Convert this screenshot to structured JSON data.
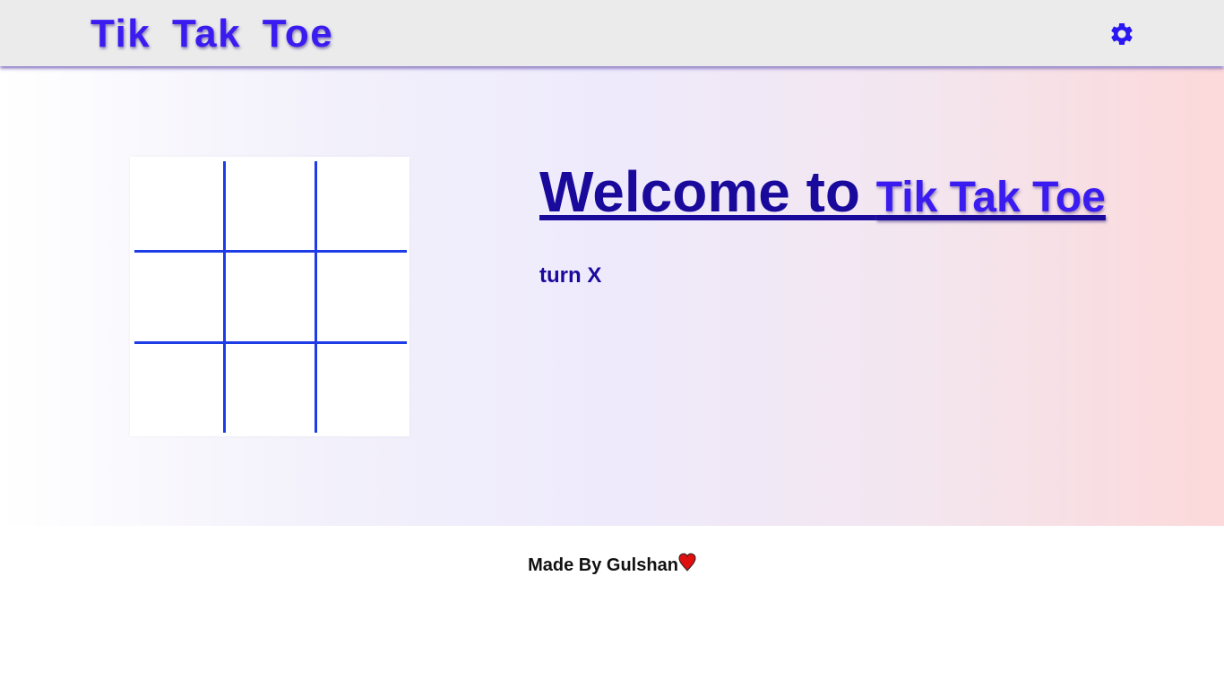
{
  "navbar": {
    "brand": "Tik  Tak  Toe",
    "settings_icon": "gear-icon",
    "brand_color": "#3a1cf0"
  },
  "board": {
    "cells": [
      "",
      "",
      "",
      "",
      "",
      "",
      "",
      "",
      ""
    ],
    "line_color": "#1d3ce6"
  },
  "info": {
    "welcome_prefix": "Welcome to ",
    "game_name": "Tik Tak Toe",
    "turn_text": "turn X"
  },
  "footer": {
    "text": "Made By Gulshan",
    "heart_icon": "heart-icon",
    "heart_color": "#e01010"
  }
}
